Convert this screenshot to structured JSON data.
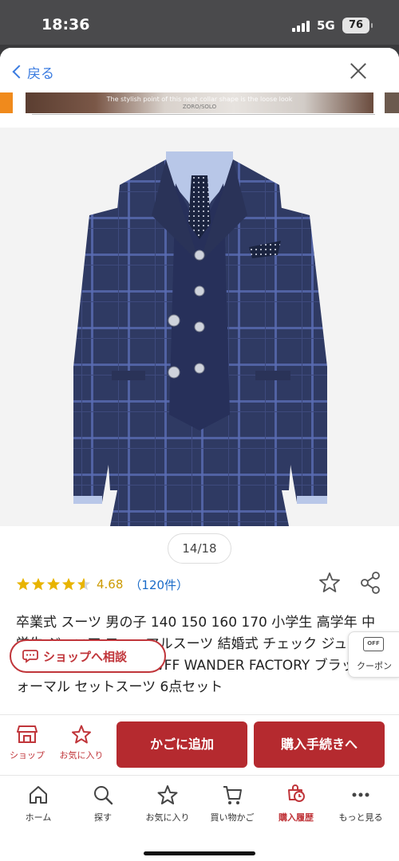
{
  "status_bar": {
    "time": "18:36",
    "network": "5G",
    "battery": "76"
  },
  "header": {
    "back_label": "戻る",
    "back_icon": "chevron-left-icon",
    "close_icon": "close-icon"
  },
  "banner": {
    "caption": "The stylish point of this neat collar shape is the loose look",
    "sub_caption": "ZORO/SOLO"
  },
  "gallery": {
    "counter": "14/18"
  },
  "rating": {
    "stars": 4.5,
    "value": "4.68",
    "reviews": "（120件）"
  },
  "product": {
    "title": "卒業式 スーツ 男の子 140 150 160 170 小学生 高学年 中学生 ジュニア フォーマルスーツ 結婚式 チェック ジュニアスーツ 冠婚葬祭 法事 WFF WANDER FACTORY ブラックフォーマル セットスーツ 6点セット"
  },
  "shop_consult": {
    "label": "ショップへ相談"
  },
  "coupon": {
    "badge": "OFF",
    "label": "クーポン"
  },
  "actions": {
    "shop": "ショップ",
    "favorite": "お気に入り",
    "add_to_cart": "かごに追加",
    "checkout": "購入手続きへ"
  },
  "bottom_nav": [
    {
      "label": "ホーム",
      "icon": "home-icon"
    },
    {
      "label": "探す",
      "icon": "search-icon"
    },
    {
      "label": "お気に入り",
      "icon": "star-icon"
    },
    {
      "label": "買い物かご",
      "icon": "cart-icon"
    },
    {
      "label": "購入履歴",
      "icon": "history-icon",
      "active": true
    },
    {
      "label": "もっと見る",
      "icon": "more-icon"
    }
  ],
  "colors": {
    "accent": "#b52a2f",
    "link": "#3a7be0",
    "star": "#e8b400",
    "suit": "#2f3a63"
  }
}
